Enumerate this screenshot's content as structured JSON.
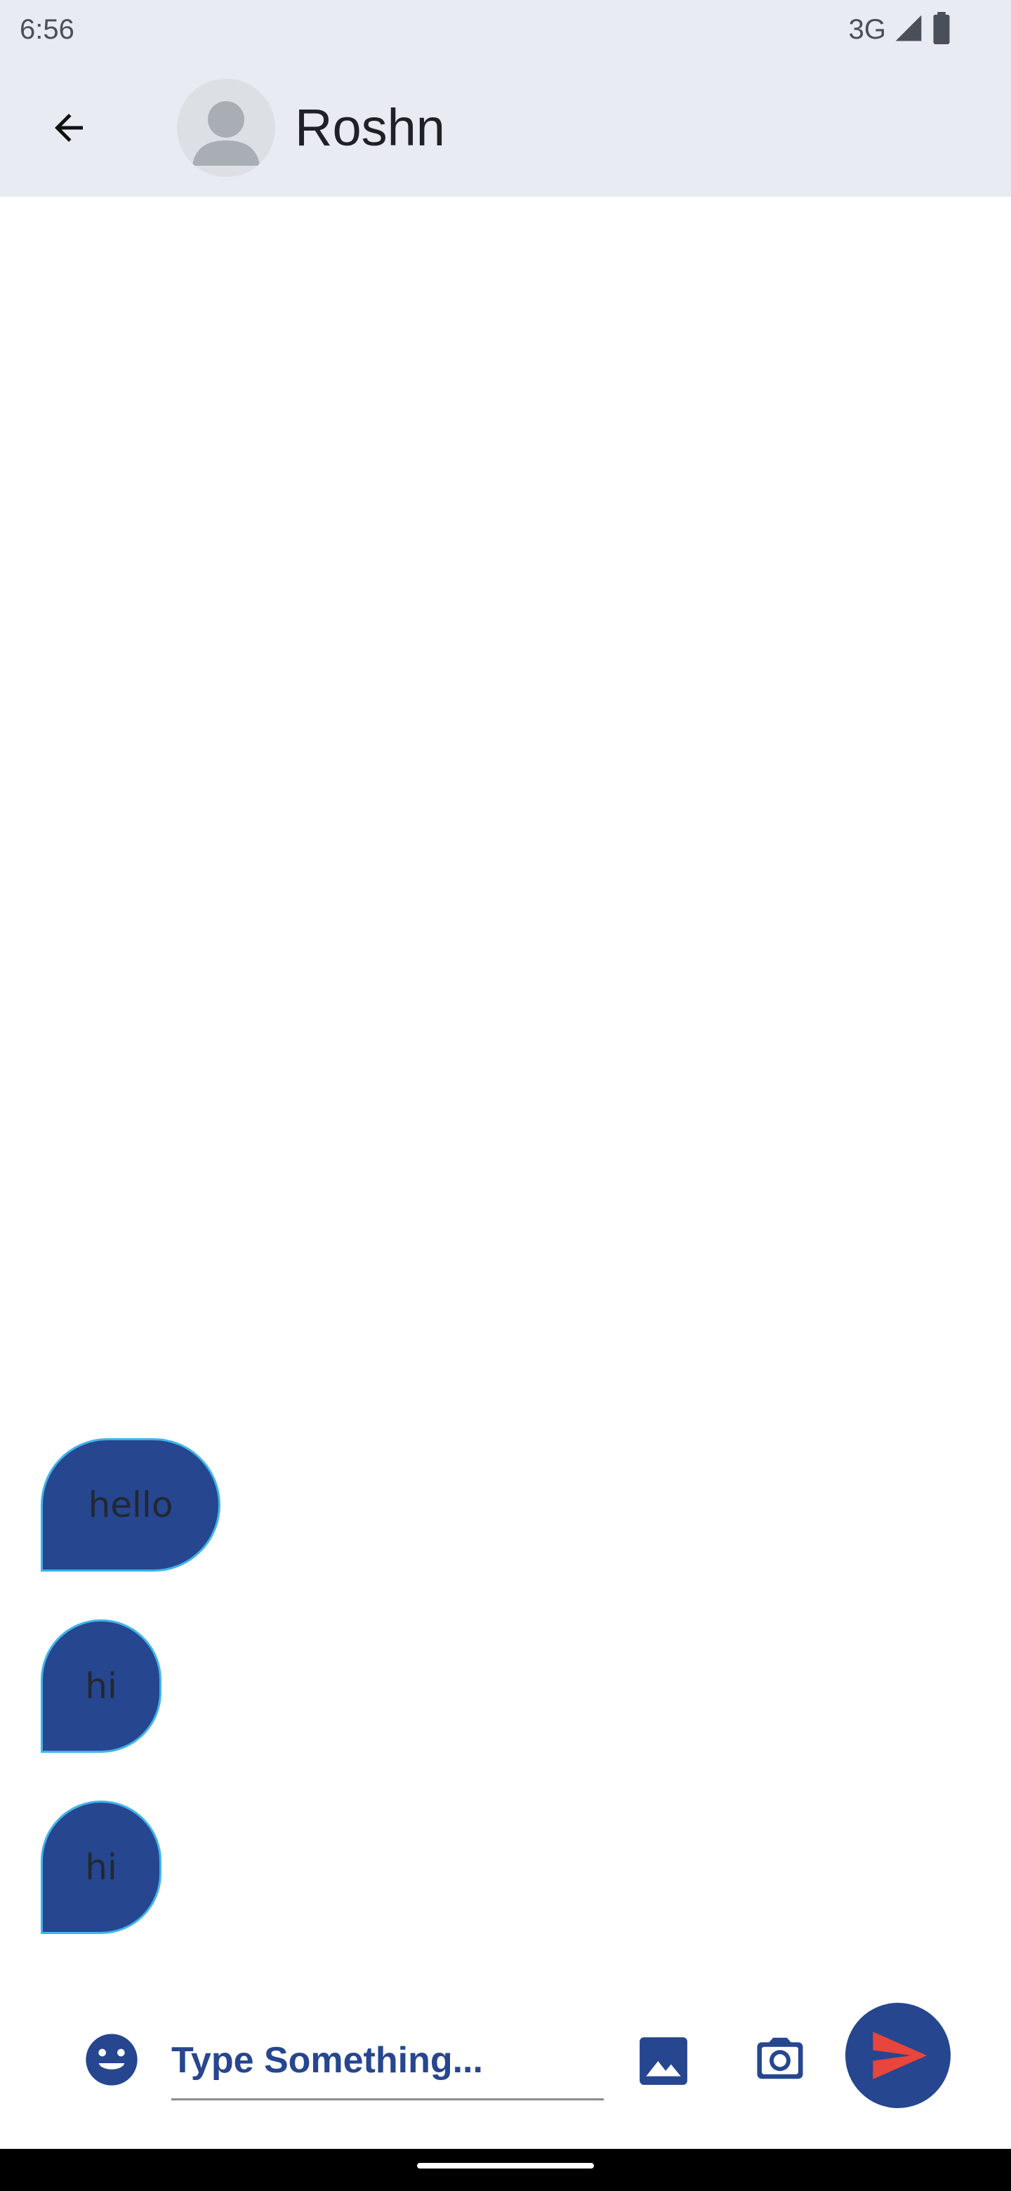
{
  "status_bar": {
    "time": "6:56",
    "network": "3G",
    "icons": [
      "cellular-signal-icon",
      "battery-icon"
    ]
  },
  "header": {
    "back_icon": "arrow-back-icon",
    "avatar_icon": "person-avatar-icon",
    "contact_name": "Roshn"
  },
  "messages": [
    {
      "text": "hello"
    },
    {
      "text": "hi"
    },
    {
      "text": "hi"
    }
  ],
  "composer": {
    "placeholder": "Type Something...",
    "value": "",
    "icons": [
      "emoji-icon",
      "image-icon",
      "camera-icon",
      "send-icon"
    ]
  },
  "colors": {
    "app_bar_bg": "#e8ebf2",
    "bubble_fill": "#26468f",
    "bubble_border": "#3fb4ec",
    "accent": "#26468f",
    "send_arrow": "#e8453c"
  }
}
